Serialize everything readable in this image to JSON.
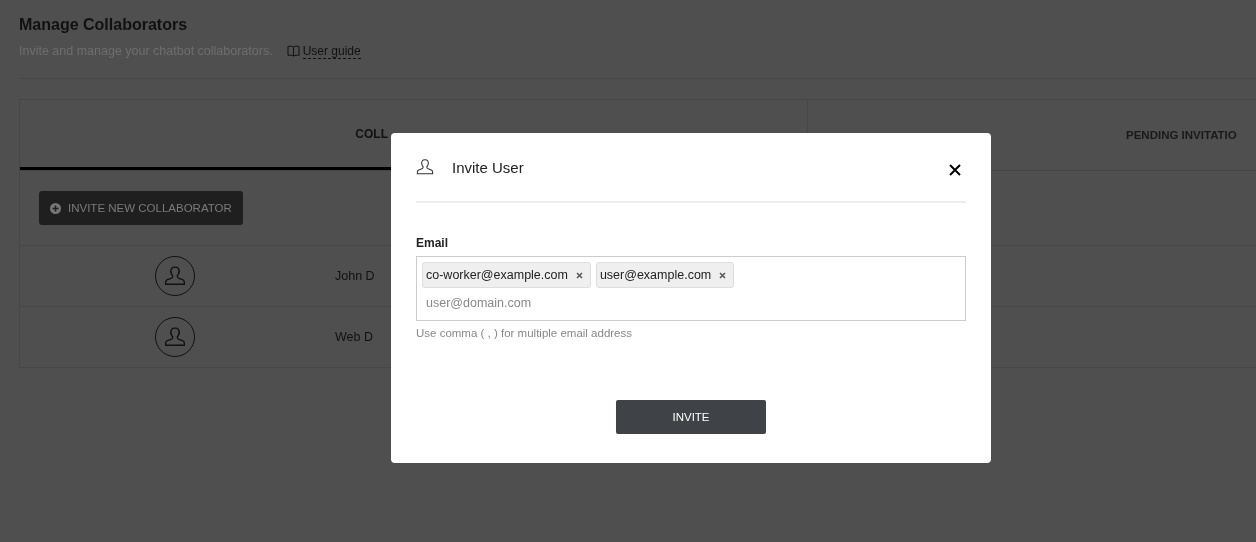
{
  "page": {
    "title": "Manage Collaborators",
    "subtitle": "Invite and manage your chatbot collaborators.",
    "user_guide_link": "User guide"
  },
  "tabs": [
    {
      "label": "COLL",
      "selected": true
    },
    {
      "label": "PENDING INVITATIO",
      "selected": false
    }
  ],
  "invite_button": "INVITE NEW COLLABORATOR",
  "collaborators": [
    {
      "name": "John D"
    },
    {
      "name": "Web D"
    }
  ],
  "dialog": {
    "title": "Invite User",
    "email_label": "Email",
    "chips": [
      "co-worker@example.com",
      "user@example.com"
    ],
    "placeholder": "user@domain.com",
    "help": "Use comma ( , ) for multiple email address",
    "submit": "INVITE"
  }
}
